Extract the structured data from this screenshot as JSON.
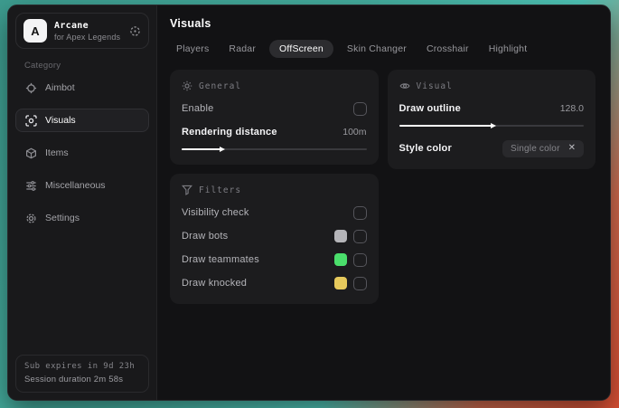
{
  "app": {
    "logo_letter": "A",
    "name": "Arcane",
    "subtitle": "for Apex Legends"
  },
  "sidebar": {
    "category_label": "Category",
    "items": [
      {
        "label": "Aimbot",
        "icon": "crosshair-icon"
      },
      {
        "label": "Visuals",
        "icon": "scan-eye-icon"
      },
      {
        "label": "Items",
        "icon": "cube-icon"
      },
      {
        "label": "Miscellaneous",
        "icon": "sliders-icon"
      },
      {
        "label": "Settings",
        "icon": "gear-icon"
      }
    ],
    "footer": {
      "line1": "Sub expires in 9d 23h",
      "line2": "Session duration 2m 58s"
    }
  },
  "main": {
    "title": "Visuals",
    "tabs": [
      {
        "label": "Players"
      },
      {
        "label": "Radar"
      },
      {
        "label": "OffScreen"
      },
      {
        "label": "Skin Changer"
      },
      {
        "label": "Crosshair"
      },
      {
        "label": "Highlight"
      }
    ],
    "selected_tab": "OffScreen",
    "general": {
      "title": "General",
      "enable_label": "Enable",
      "enable_checked": false,
      "rendering_label": "Rendering distance",
      "rendering_value": "100m",
      "rendering_fill": "21%"
    },
    "visual": {
      "title": "Visual",
      "outline_label": "Draw outline",
      "outline_value": "128.0",
      "outline_fill": "50%",
      "style_label": "Style color",
      "style_value": "Single color",
      "close_glyph": "✕"
    },
    "filters": {
      "title": "Filters",
      "rows": [
        {
          "label": "Visibility check",
          "swatch": null,
          "checked": false
        },
        {
          "label": "Draw bots",
          "swatch": "#b5b5b9",
          "checked": false
        },
        {
          "label": "Draw teammates",
          "swatch": "#4ade6b",
          "checked": false
        },
        {
          "label": "Draw knocked",
          "swatch": "#e6c95c",
          "checked": false
        }
      ]
    }
  },
  "colors": {
    "background_teal": "#45ae9f",
    "background_red": "#da4f33",
    "panel": "#1c1c1e",
    "accent_selected": "#2c2c2f"
  }
}
